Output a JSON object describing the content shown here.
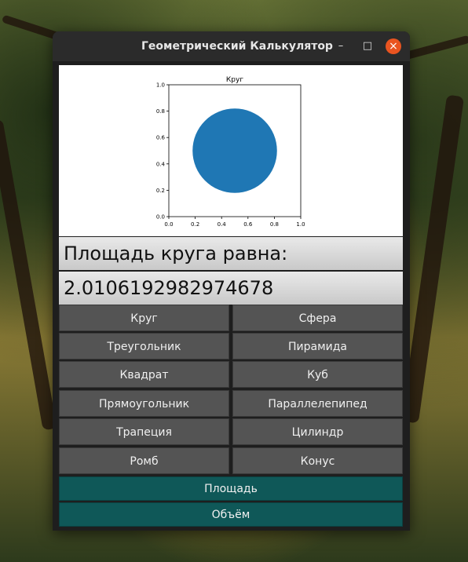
{
  "window": {
    "title": "Геометрический Калькулятор"
  },
  "plot": {
    "title": "Круг",
    "x_ticks": [
      "0.0",
      "0.2",
      "0.4",
      "0.6",
      "0.8",
      "1.0"
    ],
    "y_ticks": [
      "0.0",
      "0.2",
      "0.4",
      "0.6",
      "0.8",
      "1.0"
    ],
    "circle_color": "#1f77b4"
  },
  "chart_data": {
    "type": "scatter",
    "title": "Круг",
    "xlim": [
      0,
      1
    ],
    "ylim": [
      0,
      1
    ],
    "shapes": [
      {
        "kind": "circle",
        "center": [
          0.5,
          0.5
        ],
        "radius": 0.32,
        "color": "#1f77b4"
      }
    ]
  },
  "result": {
    "label": "Площадь круга равна:",
    "value": "2.0106192982974678"
  },
  "shapes_left": [
    "Круг",
    "Треугольник",
    "Квадрат",
    "Прямоугольник",
    "Трапеция",
    "Ромб"
  ],
  "shapes_right": [
    "Сфера",
    "Пирамида",
    "Куб",
    "Параллелепипед",
    "Цилиндр",
    "Конус"
  ],
  "actions": {
    "area": "Площадь",
    "volume": "Объём"
  },
  "colors": {
    "button": "#545454",
    "action": "#0f5858",
    "close": "#e95420"
  }
}
